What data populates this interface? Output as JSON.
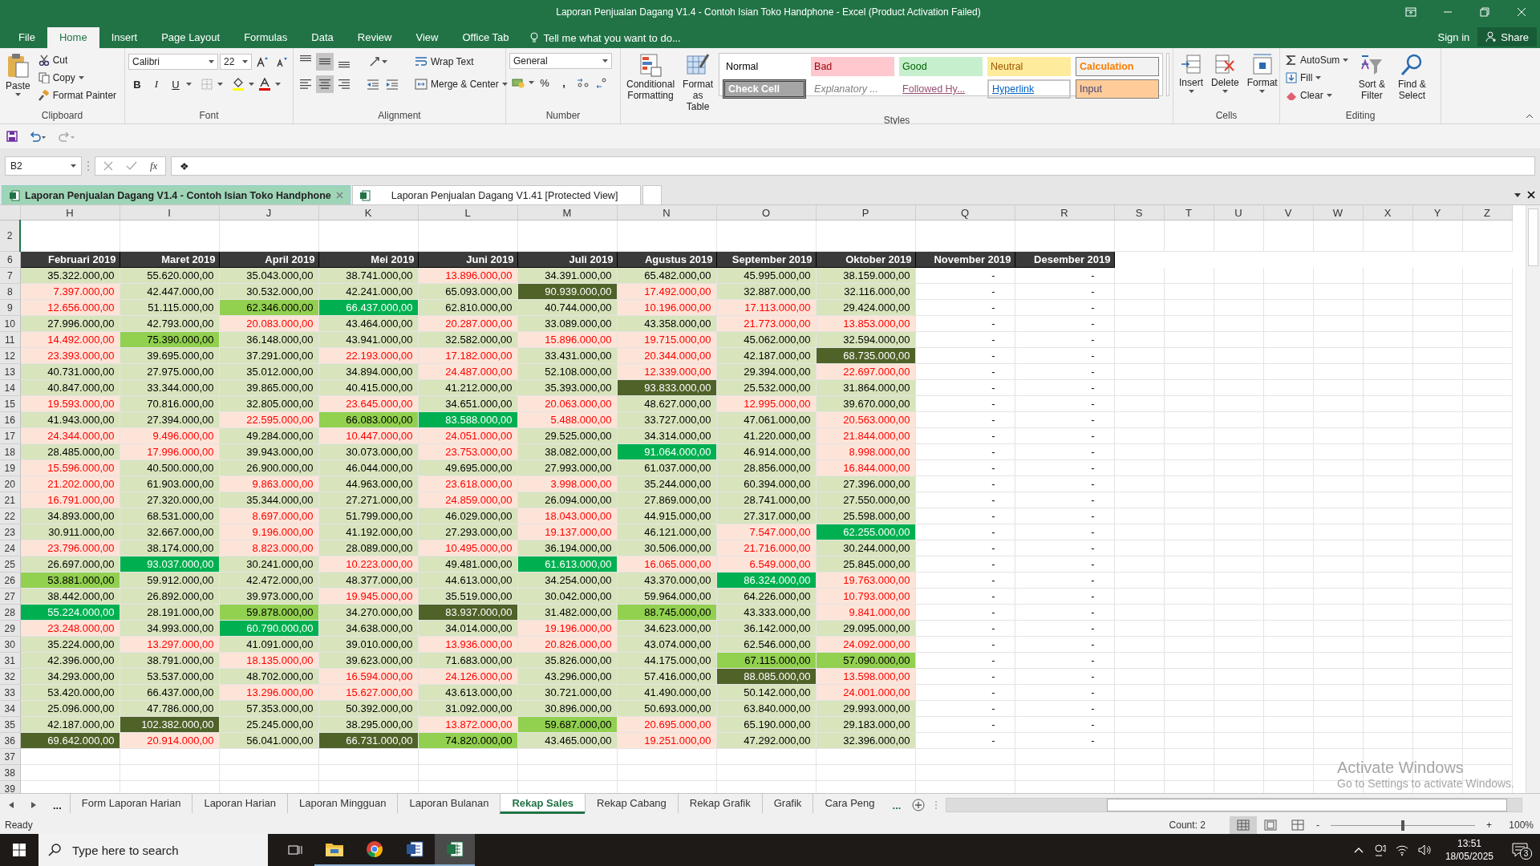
{
  "window": {
    "title": "Laporan Penjualan Dagang V1.4 - Contoh Isian Toko Handphone - Excel (Product Activation Failed)"
  },
  "ribbon_tabs": [
    {
      "label": "File",
      "selected": false
    },
    {
      "label": "Home",
      "selected": true
    },
    {
      "label": "Insert",
      "selected": false
    },
    {
      "label": "Page Layout",
      "selected": false
    },
    {
      "label": "Formulas",
      "selected": false
    },
    {
      "label": "Data",
      "selected": false
    },
    {
      "label": "Review",
      "selected": false
    },
    {
      "label": "View",
      "selected": false
    },
    {
      "label": "Office Tab",
      "selected": false
    }
  ],
  "tell_me": "Tell me what you want to do...",
  "account": {
    "sign_in": "Sign in",
    "share": "Share"
  },
  "ribbon": {
    "clipboard": {
      "label": "Clipboard",
      "paste": "Paste",
      "cut": "Cut",
      "copy": "Copy",
      "format_painter": "Format Painter"
    },
    "font": {
      "label": "Font",
      "name": "Calibri",
      "size": "22",
      "bold": "B",
      "italic": "I",
      "underline": "U"
    },
    "alignment": {
      "label": "Alignment",
      "vertical": [
        {
          "selected": false
        },
        {
          "selected": true
        },
        {
          "selected": false
        }
      ],
      "horizontal": [
        {
          "selected": false
        },
        {
          "selected": true
        },
        {
          "selected": false
        }
      ],
      "wrap_text": "Wrap Text",
      "merge": "Merge & Center"
    },
    "number": {
      "label": "Number",
      "format": "General",
      "percent": "%",
      "comma": ","
    },
    "styles": {
      "label": "Styles",
      "conditional": "Conditional Formatting",
      "format_table": "Format as Table",
      "gallery": [
        {
          "label": "Normal",
          "kind": "normal"
        },
        {
          "label": "Bad",
          "kind": "bad"
        },
        {
          "label": "Good",
          "kind": "good"
        },
        {
          "label": "Neutral",
          "kind": "neutral"
        },
        {
          "label": "Calculation",
          "kind": "calculation"
        },
        {
          "label": "Check Cell",
          "kind": "check"
        },
        {
          "label": "Explanatory ...",
          "kind": "explanatory"
        },
        {
          "label": "Followed Hy...",
          "kind": "followed"
        },
        {
          "label": "Hyperlink",
          "kind": "hyperlink"
        },
        {
          "label": "Input",
          "kind": "input"
        }
      ]
    },
    "cells": {
      "label": "Cells",
      "insert": "Insert",
      "delete": "Delete",
      "format": "Format"
    },
    "editing": {
      "label": "Editing",
      "autosum": "AutoSum",
      "fill": "Fill",
      "clear": "Clear",
      "sort": "Sort & Filter",
      "find": "Find & Select"
    }
  },
  "formula_bar": {
    "name_box": "B2",
    "fx": "fx",
    "value": "❖"
  },
  "workbook_tabs": [
    {
      "label": "Laporan Penjualan Dagang V1.4 - Contoh Isian Toko Handphone",
      "selected": true
    },
    {
      "label": "Laporan Penjualan Dagang V1.41  [Protected View]",
      "selected": false
    }
  ],
  "sheet": {
    "columns": [
      "H",
      "I",
      "J",
      "K",
      "L",
      "M",
      "N",
      "O",
      "P",
      "Q",
      "R",
      "S",
      "T",
      "U",
      "V",
      "W",
      "X",
      "Y",
      "Z"
    ],
    "header_row": {
      "num": "6",
      "cells": [
        "Februari 2019",
        "Maret 2019",
        "April 2019",
        "Mei 2019",
        "Juni 2019",
        "Juli 2019",
        "Agustus 2019",
        "September 2019",
        "Oktober 2019",
        "November 2019",
        "Desember 2019"
      ]
    },
    "rows": [
      {
        "num": "7",
        "cells": [
          {
            "value": "35.322.000,00",
            "kind": "normal"
          },
          {
            "value": "55.620.000,00",
            "kind": "normal"
          },
          {
            "value": "35.043.000,00",
            "kind": "normal"
          },
          {
            "value": "38.741.000,00",
            "kind": "normal"
          },
          {
            "value": "13.896.000,00",
            "kind": "low"
          },
          {
            "value": "34.391.000,00",
            "kind": "normal"
          },
          {
            "value": "65.482.000,00",
            "kind": "normal"
          },
          {
            "value": "45.995.000,00",
            "kind": "normal"
          },
          {
            "value": "38.159.000,00",
            "kind": "normal"
          },
          {
            "value": "-",
            "kind": "empty"
          },
          {
            "value": "-",
            "kind": "empty"
          }
        ]
      },
      {
        "num": "8",
        "cells": [
          {
            "value": "7.397.000,00",
            "kind": "low"
          },
          {
            "value": "42.447.000,00",
            "kind": "normal"
          },
          {
            "value": "30.532.000,00",
            "kind": "normal"
          },
          {
            "value": "42.241.000,00",
            "kind": "normal"
          },
          {
            "value": "65.093.000,00",
            "kind": "normal"
          },
          {
            "value": "90.939.000,00",
            "kind": "top"
          },
          {
            "value": "17.492.000,00",
            "kind": "low"
          },
          {
            "value": "32.887.000,00",
            "kind": "normal"
          },
          {
            "value": "32.116.000,00",
            "kind": "normal"
          },
          {
            "value": "-",
            "kind": "empty"
          },
          {
            "value": "-",
            "kind": "empty"
          }
        ]
      },
      {
        "num": "9",
        "cells": [
          {
            "value": "12.656.000,00",
            "kind": "low"
          },
          {
            "value": "51.115.000,00",
            "kind": "normal"
          },
          {
            "value": "62.346.000,00",
            "kind": "good"
          },
          {
            "value": "66.437.000,00",
            "kind": "high"
          },
          {
            "value": "62.810.000,00",
            "kind": "normal"
          },
          {
            "value": "40.744.000,00",
            "kind": "normal"
          },
          {
            "value": "10.196.000,00",
            "kind": "low"
          },
          {
            "value": "17.113.000,00",
            "kind": "low"
          },
          {
            "value": "29.424.000,00",
            "kind": "normal"
          },
          {
            "value": "-",
            "kind": "empty"
          },
          {
            "value": "-",
            "kind": "empty"
          }
        ]
      },
      {
        "num": "10",
        "cells": [
          {
            "value": "27.996.000,00",
            "kind": "normal"
          },
          {
            "value": "42.793.000,00",
            "kind": "normal"
          },
          {
            "value": "20.083.000,00",
            "kind": "low"
          },
          {
            "value": "43.464.000,00",
            "kind": "normal"
          },
          {
            "value": "20.287.000,00",
            "kind": "low"
          },
          {
            "value": "33.089.000,00",
            "kind": "normal"
          },
          {
            "value": "43.358.000,00",
            "kind": "normal"
          },
          {
            "value": "21.773.000,00",
            "kind": "low"
          },
          {
            "value": "13.853.000,00",
            "kind": "low"
          },
          {
            "value": "-",
            "kind": "empty"
          },
          {
            "value": "-",
            "kind": "empty"
          }
        ]
      },
      {
        "num": "11",
        "cells": [
          {
            "value": "14.492.000,00",
            "kind": "low"
          },
          {
            "value": "75.390.000,00",
            "kind": "good"
          },
          {
            "value": "36.148.000,00",
            "kind": "normal"
          },
          {
            "value": "43.941.000,00",
            "kind": "normal"
          },
          {
            "value": "32.582.000,00",
            "kind": "normal"
          },
          {
            "value": "15.896.000,00",
            "kind": "low"
          },
          {
            "value": "19.715.000,00",
            "kind": "low"
          },
          {
            "value": "45.062.000,00",
            "kind": "normal"
          },
          {
            "value": "32.594.000,00",
            "kind": "normal"
          },
          {
            "value": "-",
            "kind": "empty"
          },
          {
            "value": "-",
            "kind": "empty"
          }
        ]
      },
      {
        "num": "12",
        "cells": [
          {
            "value": "23.393.000,00",
            "kind": "low"
          },
          {
            "value": "39.695.000,00",
            "kind": "normal"
          },
          {
            "value": "37.291.000,00",
            "kind": "normal"
          },
          {
            "value": "22.193.000,00",
            "kind": "low"
          },
          {
            "value": "17.182.000,00",
            "kind": "low"
          },
          {
            "value": "33.431.000,00",
            "kind": "normal"
          },
          {
            "value": "20.344.000,00",
            "kind": "low"
          },
          {
            "value": "42.187.000,00",
            "kind": "normal"
          },
          {
            "value": "68.735.000,00",
            "kind": "top"
          },
          {
            "value": "-",
            "kind": "empty"
          },
          {
            "value": "-",
            "kind": "empty"
          }
        ]
      },
      {
        "num": "13",
        "cells": [
          {
            "value": "40.731.000,00",
            "kind": "normal"
          },
          {
            "value": "27.975.000,00",
            "kind": "normal"
          },
          {
            "value": "35.012.000,00",
            "kind": "normal"
          },
          {
            "value": "34.894.000,00",
            "kind": "normal"
          },
          {
            "value": "24.487.000,00",
            "kind": "low"
          },
          {
            "value": "52.108.000,00",
            "kind": "normal"
          },
          {
            "value": "12.339.000,00",
            "kind": "low"
          },
          {
            "value": "29.394.000,00",
            "kind": "normal"
          },
          {
            "value": "22.697.000,00",
            "kind": "low"
          },
          {
            "value": "-",
            "kind": "empty"
          },
          {
            "value": "-",
            "kind": "empty"
          }
        ]
      },
      {
        "num": "14",
        "cells": [
          {
            "value": "40.847.000,00",
            "kind": "normal"
          },
          {
            "value": "33.344.000,00",
            "kind": "normal"
          },
          {
            "value": "39.865.000,00",
            "kind": "normal"
          },
          {
            "value": "40.415.000,00",
            "kind": "normal"
          },
          {
            "value": "41.212.000,00",
            "kind": "normal"
          },
          {
            "value": "35.393.000,00",
            "kind": "normal"
          },
          {
            "value": "93.833.000,00",
            "kind": "top"
          },
          {
            "value": "25.532.000,00",
            "kind": "normal"
          },
          {
            "value": "31.864.000,00",
            "kind": "normal"
          },
          {
            "value": "-",
            "kind": "empty"
          },
          {
            "value": "-",
            "kind": "empty"
          }
        ]
      },
      {
        "num": "15",
        "cells": [
          {
            "value": "19.593.000,00",
            "kind": "low"
          },
          {
            "value": "70.816.000,00",
            "kind": "normal"
          },
          {
            "value": "32.805.000,00",
            "kind": "normal"
          },
          {
            "value": "23.645.000,00",
            "kind": "low"
          },
          {
            "value": "34.651.000,00",
            "kind": "normal"
          },
          {
            "value": "20.063.000,00",
            "kind": "low"
          },
          {
            "value": "48.627.000,00",
            "kind": "normal"
          },
          {
            "value": "12.995.000,00",
            "kind": "low"
          },
          {
            "value": "39.670.000,00",
            "kind": "normal"
          },
          {
            "value": "-",
            "kind": "empty"
          },
          {
            "value": "-",
            "kind": "empty"
          }
        ]
      },
      {
        "num": "16",
        "cells": [
          {
            "value": "41.943.000,00",
            "kind": "normal"
          },
          {
            "value": "27.394.000,00",
            "kind": "normal"
          },
          {
            "value": "22.595.000,00",
            "kind": "low"
          },
          {
            "value": "66.083.000,00",
            "kind": "good"
          },
          {
            "value": "83.588.000,00",
            "kind": "high"
          },
          {
            "value": "5.488.000,00",
            "kind": "low"
          },
          {
            "value": "33.727.000,00",
            "kind": "normal"
          },
          {
            "value": "47.061.000,00",
            "kind": "normal"
          },
          {
            "value": "20.563.000,00",
            "kind": "low"
          },
          {
            "value": "-",
            "kind": "empty"
          },
          {
            "value": "-",
            "kind": "empty"
          }
        ]
      },
      {
        "num": "17",
        "cells": [
          {
            "value": "24.344.000,00",
            "kind": "low"
          },
          {
            "value": "9.496.000,00",
            "kind": "low"
          },
          {
            "value": "49.284.000,00",
            "kind": "normal"
          },
          {
            "value": "10.447.000,00",
            "kind": "low"
          },
          {
            "value": "24.051.000,00",
            "kind": "low"
          },
          {
            "value": "29.525.000,00",
            "kind": "normal"
          },
          {
            "value": "34.314.000,00",
            "kind": "normal"
          },
          {
            "value": "41.220.000,00",
            "kind": "normal"
          },
          {
            "value": "21.844.000,00",
            "kind": "low"
          },
          {
            "value": "-",
            "kind": "empty"
          },
          {
            "value": "-",
            "kind": "empty"
          }
        ]
      },
      {
        "num": "18",
        "cells": [
          {
            "value": "28.485.000,00",
            "kind": "normal"
          },
          {
            "value": "17.996.000,00",
            "kind": "low"
          },
          {
            "value": "39.943.000,00",
            "kind": "normal"
          },
          {
            "value": "30.073.000,00",
            "kind": "normal"
          },
          {
            "value": "23.753.000,00",
            "kind": "low"
          },
          {
            "value": "38.082.000,00",
            "kind": "normal"
          },
          {
            "value": "91.064.000,00",
            "kind": "high"
          },
          {
            "value": "46.914.000,00",
            "kind": "normal"
          },
          {
            "value": "8.998.000,00",
            "kind": "low"
          },
          {
            "value": "-",
            "kind": "empty"
          },
          {
            "value": "-",
            "kind": "empty"
          }
        ]
      },
      {
        "num": "19",
        "cells": [
          {
            "value": "15.596.000,00",
            "kind": "low"
          },
          {
            "value": "40.500.000,00",
            "kind": "normal"
          },
          {
            "value": "26.900.000,00",
            "kind": "normal"
          },
          {
            "value": "46.044.000,00",
            "kind": "normal"
          },
          {
            "value": "49.695.000,00",
            "kind": "normal"
          },
          {
            "value": "27.993.000,00",
            "kind": "normal"
          },
          {
            "value": "61.037.000,00",
            "kind": "normal"
          },
          {
            "value": "28.856.000,00",
            "kind": "normal"
          },
          {
            "value": "16.844.000,00",
            "kind": "low"
          },
          {
            "value": "-",
            "kind": "empty"
          },
          {
            "value": "-",
            "kind": "empty"
          }
        ]
      },
      {
        "num": "20",
        "cells": [
          {
            "value": "21.202.000,00",
            "kind": "low"
          },
          {
            "value": "61.903.000,00",
            "kind": "normal"
          },
          {
            "value": "9.863.000,00",
            "kind": "low"
          },
          {
            "value": "44.963.000,00",
            "kind": "normal"
          },
          {
            "value": "23.618.000,00",
            "kind": "low"
          },
          {
            "value": "3.998.000,00",
            "kind": "low"
          },
          {
            "value": "35.244.000,00",
            "kind": "normal"
          },
          {
            "value": "60.394.000,00",
            "kind": "normal"
          },
          {
            "value": "27.396.000,00",
            "kind": "normal"
          },
          {
            "value": "-",
            "kind": "empty"
          },
          {
            "value": "-",
            "kind": "empty"
          }
        ]
      },
      {
        "num": "21",
        "cells": [
          {
            "value": "16.791.000,00",
            "kind": "low"
          },
          {
            "value": "27.320.000,00",
            "kind": "normal"
          },
          {
            "value": "35.344.000,00",
            "kind": "normal"
          },
          {
            "value": "27.271.000,00",
            "kind": "normal"
          },
          {
            "value": "24.859.000,00",
            "kind": "low"
          },
          {
            "value": "26.094.000,00",
            "kind": "normal"
          },
          {
            "value": "27.869.000,00",
            "kind": "normal"
          },
          {
            "value": "28.741.000,00",
            "kind": "normal"
          },
          {
            "value": "27.550.000,00",
            "kind": "normal"
          },
          {
            "value": "-",
            "kind": "empty"
          },
          {
            "value": "-",
            "kind": "empty"
          }
        ]
      },
      {
        "num": "22",
        "cells": [
          {
            "value": "34.893.000,00",
            "kind": "normal"
          },
          {
            "value": "68.531.000,00",
            "kind": "normal"
          },
          {
            "value": "8.697.000,00",
            "kind": "low"
          },
          {
            "value": "51.799.000,00",
            "kind": "normal"
          },
          {
            "value": "46.029.000,00",
            "kind": "normal"
          },
          {
            "value": "18.043.000,00",
            "kind": "low"
          },
          {
            "value": "44.915.000,00",
            "kind": "normal"
          },
          {
            "value": "27.317.000,00",
            "kind": "normal"
          },
          {
            "value": "25.598.000,00",
            "kind": "normal"
          },
          {
            "value": "-",
            "kind": "empty"
          },
          {
            "value": "-",
            "kind": "empty"
          }
        ]
      },
      {
        "num": "23",
        "cells": [
          {
            "value": "30.911.000,00",
            "kind": "normal"
          },
          {
            "value": "32.667.000,00",
            "kind": "normal"
          },
          {
            "value": "9.196.000,00",
            "kind": "low"
          },
          {
            "value": "41.192.000,00",
            "kind": "normal"
          },
          {
            "value": "27.293.000,00",
            "kind": "normal"
          },
          {
            "value": "19.137.000,00",
            "kind": "low"
          },
          {
            "value": "46.121.000,00",
            "kind": "normal"
          },
          {
            "value": "7.547.000,00",
            "kind": "low"
          },
          {
            "value": "62.255.000,00",
            "kind": "high"
          },
          {
            "value": "-",
            "kind": "empty"
          },
          {
            "value": "-",
            "kind": "empty"
          }
        ]
      },
      {
        "num": "24",
        "cells": [
          {
            "value": "23.796.000,00",
            "kind": "low"
          },
          {
            "value": "38.174.000,00",
            "kind": "normal"
          },
          {
            "value": "8.823.000,00",
            "kind": "low"
          },
          {
            "value": "28.089.000,00",
            "kind": "normal"
          },
          {
            "value": "10.495.000,00",
            "kind": "low"
          },
          {
            "value": "36.194.000,00",
            "kind": "normal"
          },
          {
            "value": "30.506.000,00",
            "kind": "normal"
          },
          {
            "value": "21.716.000,00",
            "kind": "low"
          },
          {
            "value": "30.244.000,00",
            "kind": "normal"
          },
          {
            "value": "-",
            "kind": "empty"
          },
          {
            "value": "-",
            "kind": "empty"
          }
        ]
      },
      {
        "num": "25",
        "cells": [
          {
            "value": "26.697.000,00",
            "kind": "normal"
          },
          {
            "value": "93.037.000,00",
            "kind": "high"
          },
          {
            "value": "30.241.000,00",
            "kind": "normal"
          },
          {
            "value": "10.223.000,00",
            "kind": "low"
          },
          {
            "value": "49.481.000,00",
            "kind": "normal"
          },
          {
            "value": "61.613.000,00",
            "kind": "high"
          },
          {
            "value": "16.065.000,00",
            "kind": "low"
          },
          {
            "value": "6.549.000,00",
            "kind": "low"
          },
          {
            "value": "25.845.000,00",
            "kind": "normal"
          },
          {
            "value": "-",
            "kind": "empty"
          },
          {
            "value": "-",
            "kind": "empty"
          }
        ]
      },
      {
        "num": "26",
        "cells": [
          {
            "value": "53.881.000,00",
            "kind": "good"
          },
          {
            "value": "59.912.000,00",
            "kind": "normal"
          },
          {
            "value": "42.472.000,00",
            "kind": "normal"
          },
          {
            "value": "48.377.000,00",
            "kind": "normal"
          },
          {
            "value": "44.613.000,00",
            "kind": "normal"
          },
          {
            "value": "34.254.000,00",
            "kind": "normal"
          },
          {
            "value": "43.370.000,00",
            "kind": "normal"
          },
          {
            "value": "86.324.000,00",
            "kind": "high"
          },
          {
            "value": "19.763.000,00",
            "kind": "low"
          },
          {
            "value": "-",
            "kind": "empty"
          },
          {
            "value": "-",
            "kind": "empty"
          }
        ]
      },
      {
        "num": "27",
        "cells": [
          {
            "value": "38.442.000,00",
            "kind": "normal"
          },
          {
            "value": "26.892.000,00",
            "kind": "normal"
          },
          {
            "value": "39.973.000,00",
            "kind": "normal"
          },
          {
            "value": "19.945.000,00",
            "kind": "low"
          },
          {
            "value": "35.519.000,00",
            "kind": "normal"
          },
          {
            "value": "30.042.000,00",
            "kind": "normal"
          },
          {
            "value": "59.964.000,00",
            "kind": "normal"
          },
          {
            "value": "64.226.000,00",
            "kind": "normal"
          },
          {
            "value": "10.793.000,00",
            "kind": "low"
          },
          {
            "value": "-",
            "kind": "empty"
          },
          {
            "value": "-",
            "kind": "empty"
          }
        ]
      },
      {
        "num": "28",
        "cells": [
          {
            "value": "55.224.000,00",
            "kind": "high"
          },
          {
            "value": "28.191.000,00",
            "kind": "normal"
          },
          {
            "value": "59.878.000,00",
            "kind": "good"
          },
          {
            "value": "34.270.000,00",
            "kind": "normal"
          },
          {
            "value": "83.937.000,00",
            "kind": "top"
          },
          {
            "value": "31.482.000,00",
            "kind": "normal"
          },
          {
            "value": "88.745.000,00",
            "kind": "good"
          },
          {
            "value": "43.333.000,00",
            "kind": "normal"
          },
          {
            "value": "9.841.000,00",
            "kind": "low"
          },
          {
            "value": "-",
            "kind": "empty"
          },
          {
            "value": "-",
            "kind": "empty"
          }
        ]
      },
      {
        "num": "29",
        "cells": [
          {
            "value": "23.248.000,00",
            "kind": "low"
          },
          {
            "value": "34.993.000,00",
            "kind": "normal"
          },
          {
            "value": "60.790.000,00",
            "kind": "high"
          },
          {
            "value": "34.638.000,00",
            "kind": "normal"
          },
          {
            "value": "34.014.000,00",
            "kind": "normal"
          },
          {
            "value": "19.196.000,00",
            "kind": "low"
          },
          {
            "value": "34.623.000,00",
            "kind": "normal"
          },
          {
            "value": "36.142.000,00",
            "kind": "normal"
          },
          {
            "value": "29.095.000,00",
            "kind": "normal"
          },
          {
            "value": "-",
            "kind": "empty"
          },
          {
            "value": "-",
            "kind": "empty"
          }
        ]
      },
      {
        "num": "30",
        "cells": [
          {
            "value": "35.224.000,00",
            "kind": "normal"
          },
          {
            "value": "13.297.000,00",
            "kind": "low"
          },
          {
            "value": "41.091.000,00",
            "kind": "normal"
          },
          {
            "value": "39.010.000,00",
            "kind": "normal"
          },
          {
            "value": "13.936.000,00",
            "kind": "low"
          },
          {
            "value": "20.826.000,00",
            "kind": "low"
          },
          {
            "value": "43.074.000,00",
            "kind": "normal"
          },
          {
            "value": "62.546.000,00",
            "kind": "normal"
          },
          {
            "value": "24.092.000,00",
            "kind": "low"
          },
          {
            "value": "-",
            "kind": "empty"
          },
          {
            "value": "-",
            "kind": "empty"
          }
        ]
      },
      {
        "num": "31",
        "cells": [
          {
            "value": "42.396.000,00",
            "kind": "normal"
          },
          {
            "value": "38.791.000,00",
            "kind": "normal"
          },
          {
            "value": "18.135.000,00",
            "kind": "low"
          },
          {
            "value": "39.623.000,00",
            "kind": "normal"
          },
          {
            "value": "71.683.000,00",
            "kind": "normal"
          },
          {
            "value": "35.826.000,00",
            "kind": "normal"
          },
          {
            "value": "44.175.000,00",
            "kind": "normal"
          },
          {
            "value": "67.115.000,00",
            "kind": "good"
          },
          {
            "value": "57.090.000,00",
            "kind": "good"
          },
          {
            "value": "-",
            "kind": "empty"
          },
          {
            "value": "-",
            "kind": "empty"
          }
        ]
      },
      {
        "num": "32",
        "cells": [
          {
            "value": "34.293.000,00",
            "kind": "normal"
          },
          {
            "value": "53.537.000,00",
            "kind": "normal"
          },
          {
            "value": "48.702.000,00",
            "kind": "normal"
          },
          {
            "value": "16.594.000,00",
            "kind": "low"
          },
          {
            "value": "24.126.000,00",
            "kind": "low"
          },
          {
            "value": "43.296.000,00",
            "kind": "normal"
          },
          {
            "value": "57.416.000,00",
            "kind": "normal"
          },
          {
            "value": "88.085.000,00",
            "kind": "top"
          },
          {
            "value": "13.598.000,00",
            "kind": "low"
          },
          {
            "value": "-",
            "kind": "empty"
          },
          {
            "value": "-",
            "kind": "empty"
          }
        ]
      },
      {
        "num": "33",
        "cells": [
          {
            "value": "53.420.000,00",
            "kind": "normal"
          },
          {
            "value": "66.437.000,00",
            "kind": "normal"
          },
          {
            "value": "13.296.000,00",
            "kind": "low"
          },
          {
            "value": "15.627.000,00",
            "kind": "low"
          },
          {
            "value": "43.613.000,00",
            "kind": "normal"
          },
          {
            "value": "30.721.000,00",
            "kind": "normal"
          },
          {
            "value": "41.490.000,00",
            "kind": "normal"
          },
          {
            "value": "50.142.000,00",
            "kind": "normal"
          },
          {
            "value": "24.001.000,00",
            "kind": "low"
          },
          {
            "value": "-",
            "kind": "empty"
          },
          {
            "value": "-",
            "kind": "empty"
          }
        ]
      },
      {
        "num": "34",
        "cells": [
          {
            "value": "25.096.000,00",
            "kind": "normal"
          },
          {
            "value": "47.786.000,00",
            "kind": "normal"
          },
          {
            "value": "57.353.000,00",
            "kind": "normal"
          },
          {
            "value": "50.392.000,00",
            "kind": "normal"
          },
          {
            "value": "31.092.000,00",
            "kind": "normal"
          },
          {
            "value": "30.896.000,00",
            "kind": "normal"
          },
          {
            "value": "50.693.000,00",
            "kind": "normal"
          },
          {
            "value": "63.840.000,00",
            "kind": "normal"
          },
          {
            "value": "29.993.000,00",
            "kind": "normal"
          },
          {
            "value": "-",
            "kind": "empty"
          },
          {
            "value": "-",
            "kind": "empty"
          }
        ]
      },
      {
        "num": "35",
        "cells": [
          {
            "value": "42.187.000,00",
            "kind": "normal"
          },
          {
            "value": "102.382.000,00",
            "kind": "top"
          },
          {
            "value": "25.245.000,00",
            "kind": "normal"
          },
          {
            "value": "38.295.000,00",
            "kind": "normal"
          },
          {
            "value": "13.872.000,00",
            "kind": "low"
          },
          {
            "value": "59.687.000,00",
            "kind": "good"
          },
          {
            "value": "20.695.000,00",
            "kind": "low"
          },
          {
            "value": "65.190.000,00",
            "kind": "normal"
          },
          {
            "value": "29.183.000,00",
            "kind": "normal"
          },
          {
            "value": "-",
            "kind": "empty"
          },
          {
            "value": "-",
            "kind": "empty"
          }
        ]
      },
      {
        "num": "36",
        "cells": [
          {
            "value": "69.642.000,00",
            "kind": "top"
          },
          {
            "value": "20.914.000,00",
            "kind": "low"
          },
          {
            "value": "56.041.000,00",
            "kind": "normal"
          },
          {
            "value": "66.731.000,00",
            "kind": "top"
          },
          {
            "value": "74.820.000,00",
            "kind": "good"
          },
          {
            "value": "43.465.000,00",
            "kind": "normal"
          },
          {
            "value": "19.251.000,00",
            "kind": "low"
          },
          {
            "value": "47.292.000,00",
            "kind": "normal"
          },
          {
            "value": "32.396.000,00",
            "kind": "normal"
          },
          {
            "value": "-",
            "kind": "empty"
          },
          {
            "value": "-",
            "kind": "empty"
          }
        ]
      }
    ],
    "top_rows": [
      "2"
    ],
    "empty_rows": [
      "37",
      "38",
      "39"
    ]
  },
  "activation_notice": {
    "title": "Activate Windows",
    "text": "Go to Settings to activate Windows."
  },
  "sheet_tabs": {
    "more": "...",
    "tabs": [
      {
        "label": "Form Laporan Harian",
        "selected": false
      },
      {
        "label": "Laporan Harian",
        "selected": false
      },
      {
        "label": "Laporan Mingguan",
        "selected": false
      },
      {
        "label": "Laporan Bulanan",
        "selected": false
      },
      {
        "label": "Rekap Sales",
        "selected": true
      },
      {
        "label": "Rekap Cabang",
        "selected": false
      },
      {
        "label": "Rekap Grafik",
        "selected": false
      },
      {
        "label": "Grafik",
        "selected": false
      },
      {
        "label": "Cara Peng",
        "selected": false
      }
    ],
    "more_right": "..."
  },
  "status_bar": {
    "status": "Ready",
    "count": "Count: 2",
    "zoom": {
      "minus": "-",
      "plus": "+",
      "level": 0.5,
      "reading": "100%"
    }
  },
  "taskbar": {
    "search_placeholder": "Type here to search",
    "apps": [
      {
        "kind": "explorer",
        "selected": false
      },
      {
        "kind": "chrome",
        "selected": false
      },
      {
        "kind": "word",
        "selected": false
      },
      {
        "kind": "excel",
        "selected": true
      }
    ],
    "time": "13:51",
    "date": "18/05/2025",
    "notifications": "3"
  }
}
